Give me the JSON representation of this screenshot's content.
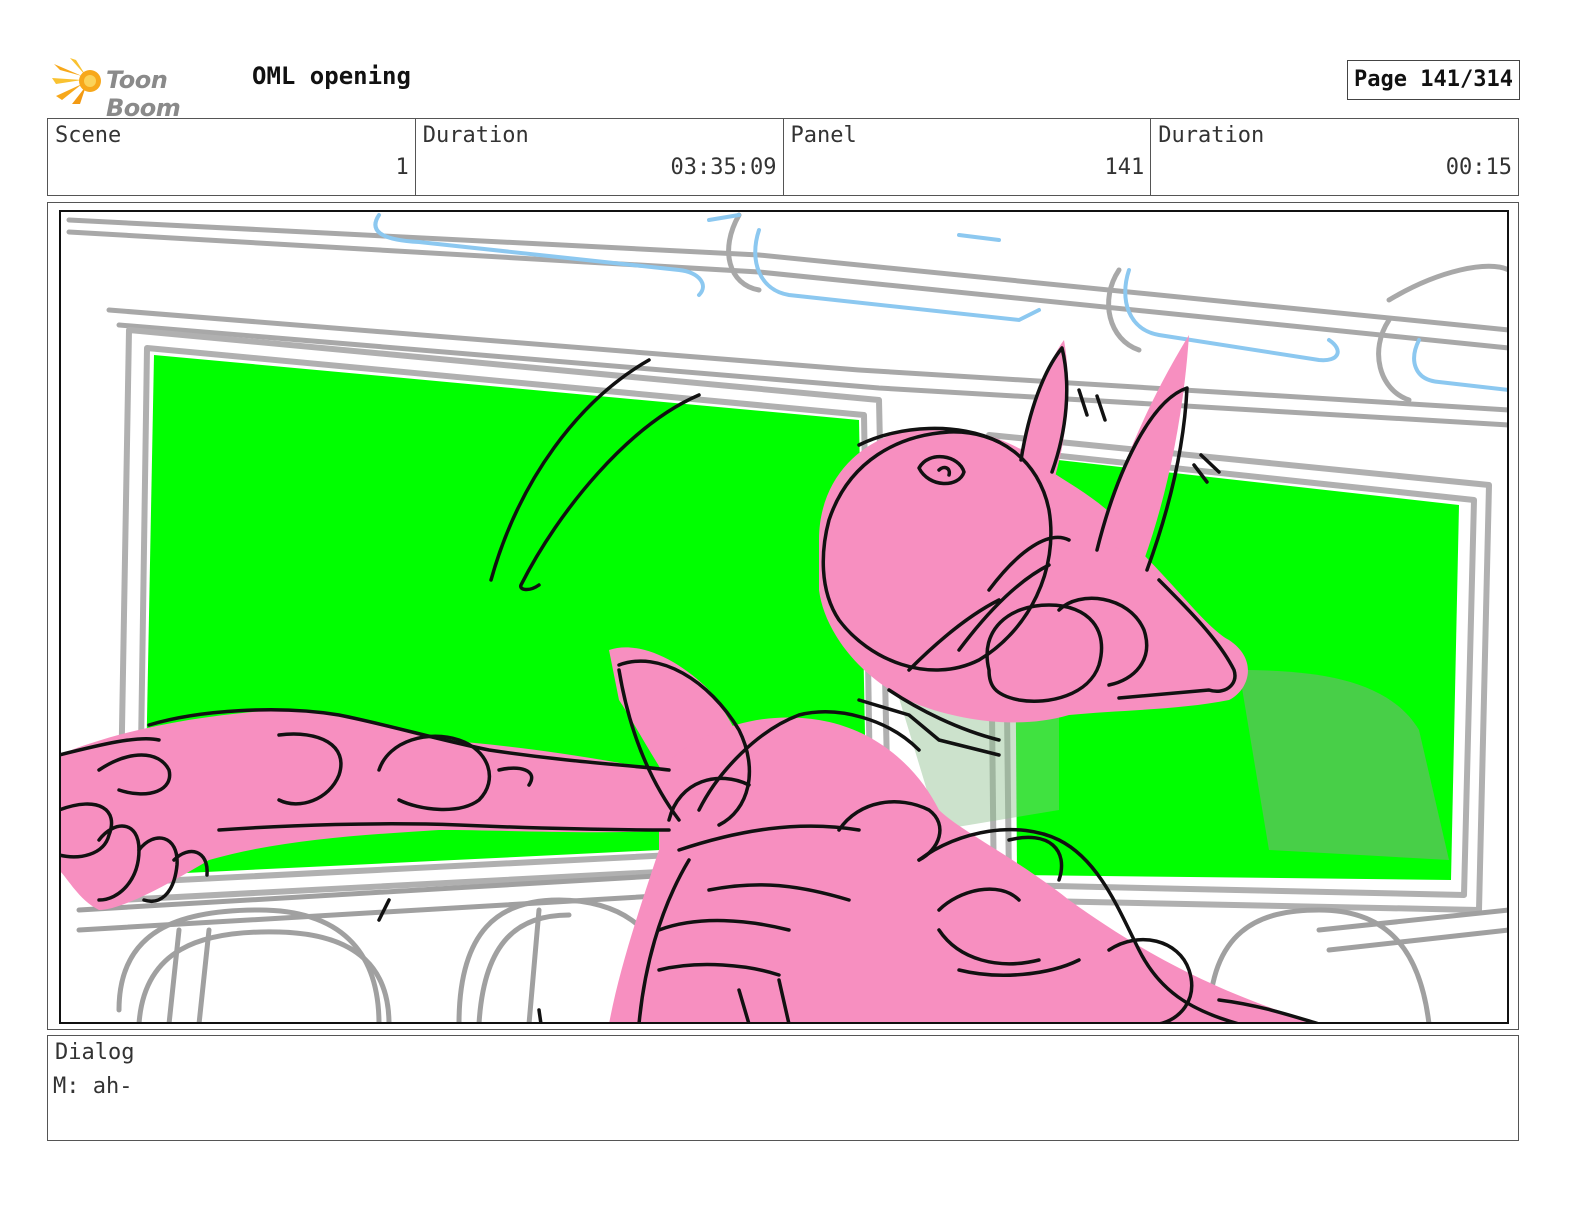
{
  "header": {
    "logo_text": "Toon Boom",
    "project_title": "OML opening",
    "page_label": "Page 141/314"
  },
  "info": {
    "scene_label": "Scene",
    "scene_value": "1",
    "duration_label": "Duration",
    "duration_value": "03:35:09",
    "panel_label": "Panel",
    "panel_value": "141",
    "panel_duration_label": "Duration",
    "panel_duration_value": "00:15"
  },
  "dialog": {
    "label": "Dialog",
    "text": "M: ah-"
  },
  "colors": {
    "screen_green": "#00ff00",
    "character_pink": "#f78fc0",
    "sketch_gray": "#a8a8a8",
    "sketch_blue": "#8cc8f0",
    "line_black": "#111111",
    "logo_orange": "#f7a81b"
  }
}
